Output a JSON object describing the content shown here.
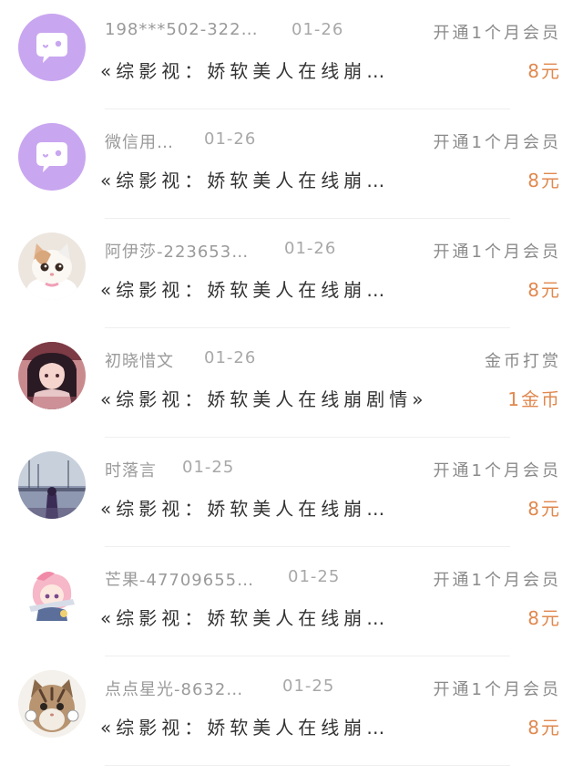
{
  "accent_color": "#e0884f",
  "records": [
    {
      "avatar": "wechat-bubble-icon",
      "name": "198***502-3220…",
      "date": "01-26",
      "action": "开通1个月会员",
      "title": "«综影视：娇软美人在线崩…",
      "amount": "8元"
    },
    {
      "avatar": "wechat-bubble-icon",
      "name": "微信用…",
      "date": "01-26",
      "action": "开通1个月会员",
      "title": "«综影视：娇软美人在线崩…",
      "amount": "8元"
    },
    {
      "avatar": "cat-photo",
      "name": "阿伊莎-223653…",
      "date": "01-26",
      "action": "开通1个月会员",
      "title": "«综影视：娇软美人在线崩…",
      "amount": "8元"
    },
    {
      "avatar": "anime-girl-photo",
      "name": "初晓惜文",
      "date": "01-26",
      "action": "金币打赏",
      "title": "«综影视：娇软美人在线崩剧情»",
      "amount": "1金币"
    },
    {
      "avatar": "harbor-girl-photo",
      "name": "时落言",
      "date": "01-25",
      "action": "开通1个月会员",
      "title": "«综影视：娇软美人在线崩…",
      "amount": "8元"
    },
    {
      "avatar": "anime-pink-girl-photo",
      "name": "芒果-47709655…",
      "date": "01-25",
      "action": "开通1个月会员",
      "title": "«综影视：娇软美人在线崩…",
      "amount": "8元"
    },
    {
      "avatar": "tabby-cat-photo",
      "name": "点点星光-8632…",
      "date": "01-25",
      "action": "开通1个月会员",
      "title": "«综影视：娇软美人在线崩…",
      "amount": "8元"
    }
  ]
}
